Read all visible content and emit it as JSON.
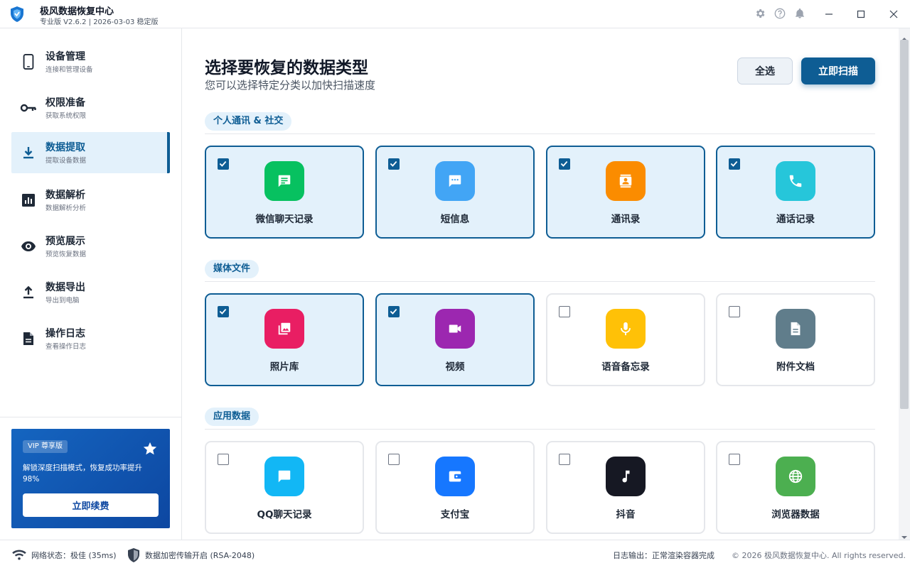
{
  "app": {
    "title": "极风数据恢复中心",
    "version": "专业版 V2.6.2 | 2026-03-03 稳定版"
  },
  "sidebar": {
    "items": [
      {
        "label": "设备管理",
        "sub": "连接和管理设备",
        "icon": "phone-icon"
      },
      {
        "label": "权限准备",
        "sub": "获取系统权限",
        "icon": "key-icon"
      },
      {
        "label": "数据提取",
        "sub": "提取设备数据",
        "icon": "download-icon",
        "active": true
      },
      {
        "label": "数据解析",
        "sub": "数据解析分析",
        "icon": "analytics-icon"
      },
      {
        "label": "预览展示",
        "sub": "预览恢复数据",
        "icon": "eye-icon"
      },
      {
        "label": "数据导出",
        "sub": "导出到电脑",
        "icon": "upload-icon"
      },
      {
        "label": "操作日志",
        "sub": "查看操作日志",
        "icon": "document-icon"
      }
    ],
    "vip": {
      "badge": "VIP 尊享版",
      "text": "解锁深度扫描模式，恢复成功率提升98%",
      "button": "立即续费"
    }
  },
  "main": {
    "title": "选择要恢复的数据类型",
    "subtitle": "您可以选择特定分类以加快扫描速度",
    "select_all": "全选",
    "scan_now": "立即扫描",
    "sections": [
      {
        "label": "个人通讯 & 社交",
        "cards": [
          {
            "label": "微信聊天记录",
            "checked": true,
            "color": "#07c160",
            "icon": "wechat-icon"
          },
          {
            "label": "短信息",
            "checked": true,
            "color": "#42a5f5",
            "icon": "sms-icon"
          },
          {
            "label": "通讯录",
            "checked": true,
            "color": "#fb8c00",
            "icon": "contacts-icon"
          },
          {
            "label": "通话记录",
            "checked": true,
            "color": "#26c6da",
            "icon": "phone-call-icon"
          }
        ]
      },
      {
        "label": "媒体文件",
        "cards": [
          {
            "label": "照片库",
            "checked": true,
            "color": "#e91e63",
            "icon": "photo-icon"
          },
          {
            "label": "视频",
            "checked": true,
            "color": "#9c27b0",
            "icon": "video-icon"
          },
          {
            "label": "语音备忘录",
            "checked": false,
            "color": "#ffc107",
            "icon": "microphone-icon"
          },
          {
            "label": "附件文档",
            "checked": false,
            "color": "#607d8b",
            "icon": "file-icon"
          }
        ]
      },
      {
        "label": "应用数据",
        "cards": [
          {
            "label": "QQ聊天记录",
            "checked": false,
            "color": "#12b7f5",
            "icon": "chat-icon"
          },
          {
            "label": "支付宝",
            "checked": false,
            "color": "#1677ff",
            "icon": "wallet-icon"
          },
          {
            "label": "抖音",
            "checked": false,
            "color": "#161823",
            "icon": "music-note-icon"
          },
          {
            "label": "浏览器数据",
            "checked": false,
            "color": "#4caf50",
            "icon": "globe-icon"
          }
        ]
      }
    ]
  },
  "status": {
    "network": "网络状态：极佳 (35ms)",
    "encryption": "数据加密传输开启 (RSA-2048)",
    "log": "日志输出：正常渲染容器完成",
    "copyright": "© 2026 极风数据恢复中心. All rights reserved."
  },
  "colors": {
    "accent": "#0e5d94",
    "selected_bg": "#e3f1fb"
  }
}
